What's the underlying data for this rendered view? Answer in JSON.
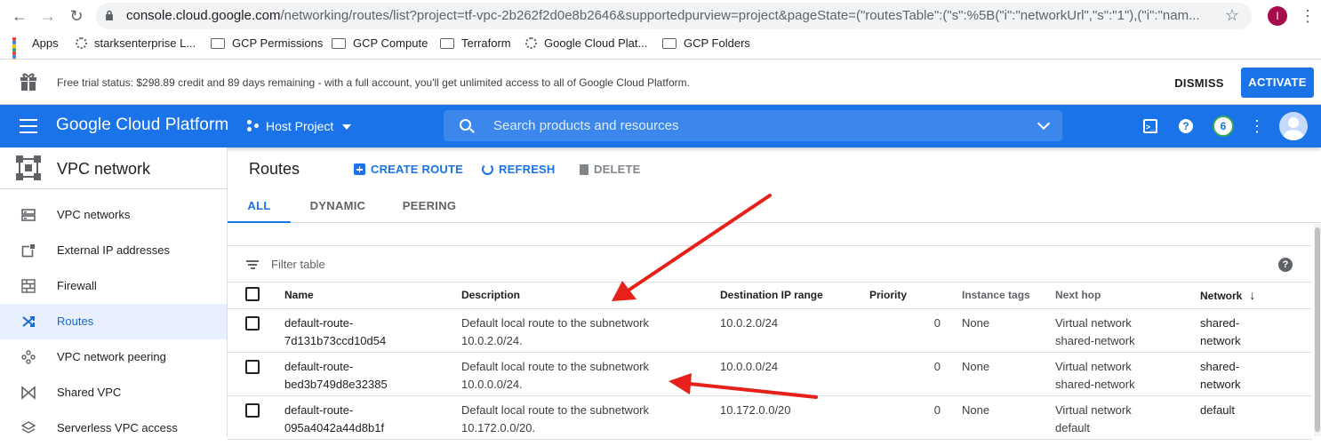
{
  "browser": {
    "url_host": "console.cloud.google.com",
    "url_rest": "/networking/routes/list?project=tf-vpc-2b262f2d0e8b2646&supportedpurview=project&pageState=(\"routesTable\":(\"s\":%5B(\"i\":\"networkUrl\",\"s\":\"1\"),(\"i\":\"nam...",
    "avatar_letter": "I",
    "bookmarks": [
      {
        "label": "Apps",
        "icon": "apps-grid-icon"
      },
      {
        "label": "starksenterprise L...",
        "icon": "gear-icon"
      },
      {
        "label": "GCP Permissions",
        "icon": "folder-icon"
      },
      {
        "label": "GCP Compute",
        "icon": "folder-icon"
      },
      {
        "label": "Terraform",
        "icon": "folder-icon"
      },
      {
        "label": "Google Cloud Plat...",
        "icon": "gear-icon"
      },
      {
        "label": "GCP Folders",
        "icon": "folder-icon"
      }
    ]
  },
  "banner": {
    "message": "Free trial status: $298.89 credit and 89 days remaining - with a full account, you'll get unlimited access to all of Google Cloud Platform.",
    "dismiss": "DISMISS",
    "activate": "ACTIVATE"
  },
  "header": {
    "brand": "Google Cloud Platform",
    "project": "Host Project",
    "search_placeholder": "Search products and resources",
    "notification_count": "6",
    "accent": "#1a73e8"
  },
  "sidebar": {
    "title": "VPC network",
    "items": [
      {
        "label": "VPC networks",
        "icon": "vpc-networks-icon",
        "active": false
      },
      {
        "label": "External IP addresses",
        "icon": "external-ip-icon",
        "active": false
      },
      {
        "label": "Firewall",
        "icon": "firewall-icon",
        "active": false
      },
      {
        "label": "Routes",
        "icon": "routes-icon",
        "active": true
      },
      {
        "label": "VPC network peering",
        "icon": "peering-icon",
        "active": false
      },
      {
        "label": "Shared VPC",
        "icon": "shared-vpc-icon",
        "active": false
      },
      {
        "label": "Serverless VPC access",
        "icon": "serverless-icon",
        "active": false
      }
    ]
  },
  "main": {
    "title": "Routes",
    "create": "CREATE ROUTE",
    "refresh": "REFRESH",
    "delete": "DELETE",
    "tabs": [
      "ALL",
      "DYNAMIC",
      "PEERING"
    ],
    "filter_placeholder": "Filter table"
  },
  "table": {
    "columns": {
      "name": "Name",
      "description": "Description",
      "dest": "Destination IP range",
      "priority": "Priority",
      "tags": "Instance tags",
      "nexthop": "Next hop",
      "network": "Network",
      "sort_arrow": "↓"
    },
    "rows": [
      {
        "name1": "default-route-",
        "name2": "7d131b73ccd10d54",
        "desc1": "Default local route to the subnetwork",
        "desc2": "10.0.2.0/24.",
        "dest": "10.0.2.0/24",
        "priority": "0",
        "tags": "None",
        "hop1": "Virtual network",
        "hop2": "shared-network",
        "net1": "shared-",
        "net2": "network"
      },
      {
        "name1": "default-route-",
        "name2": "bed3b749d8e32385",
        "desc1": "Default local route to the subnetwork",
        "desc2": "10.0.0.0/24.",
        "dest": "10.0.0.0/24",
        "priority": "0",
        "tags": "None",
        "hop1": "Virtual network",
        "hop2": "shared-network",
        "net1": "shared-",
        "net2": "network"
      },
      {
        "name1": "default-route-",
        "name2": "095a4042a44d8b1f",
        "desc1": "Default local route to the subnetwork",
        "desc2": "10.172.0.0/20.",
        "dest": "10.172.0.0/20",
        "priority": "0",
        "tags": "None",
        "hop1": "Virtual network",
        "hop2": "default",
        "net1": "default",
        "net2": ""
      }
    ]
  },
  "annotation_color": "#e8201a"
}
